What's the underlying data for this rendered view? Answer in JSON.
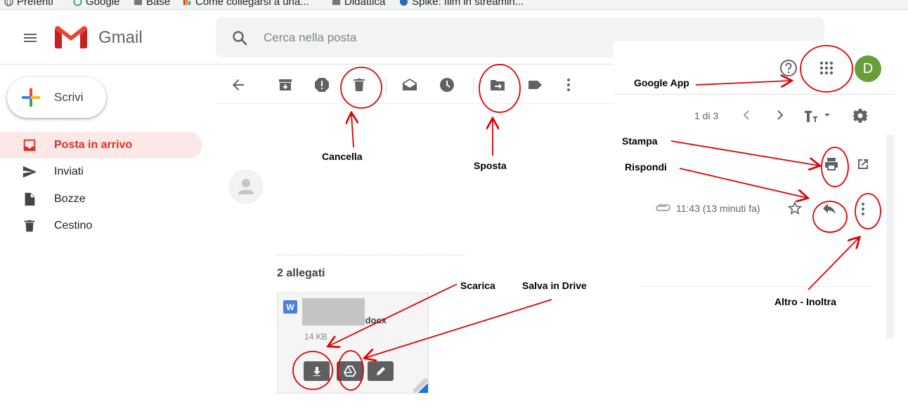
{
  "bookmarks": [
    {
      "label": "Preferiti"
    },
    {
      "label": "Google"
    },
    {
      "label": "Base"
    },
    {
      "label": "Come collegarsi a una..."
    },
    {
      "label": "Didattica"
    },
    {
      "label": "Spike: film in streamin..."
    }
  ],
  "header": {
    "brand": "Gmail",
    "search_placeholder": "Cerca nella posta"
  },
  "compose": {
    "label": "Scrivi"
  },
  "nav": [
    {
      "label": "Posta in arrivo",
      "active": true
    },
    {
      "label": "Inviati"
    },
    {
      "label": "Bozze"
    },
    {
      "label": "Cestino"
    }
  ],
  "account": {
    "avatar_letter": "D",
    "avatar_color": "#689f38"
  },
  "pager": {
    "text": "1 di 3"
  },
  "message": {
    "time": "11:43 (13 minuti fa)"
  },
  "attachments": {
    "title": "2 allegati",
    "file": {
      "name": ".docx",
      "size": "14 KB",
      "type_badge": "W"
    }
  },
  "annotations": {
    "cancella": "Cancella",
    "sposta": "Sposta",
    "google_app": "Google App",
    "stampa": "Stampa",
    "rispondi": "Rispondi",
    "scarica": "Scarica",
    "salva_drive": "Salva in Drive",
    "altro_inoltra": "Altro - Inoltra"
  },
  "colors": {
    "accent_red": "#d93025",
    "annotation_red": "#e00000",
    "icon_gray": "#5f6368"
  }
}
